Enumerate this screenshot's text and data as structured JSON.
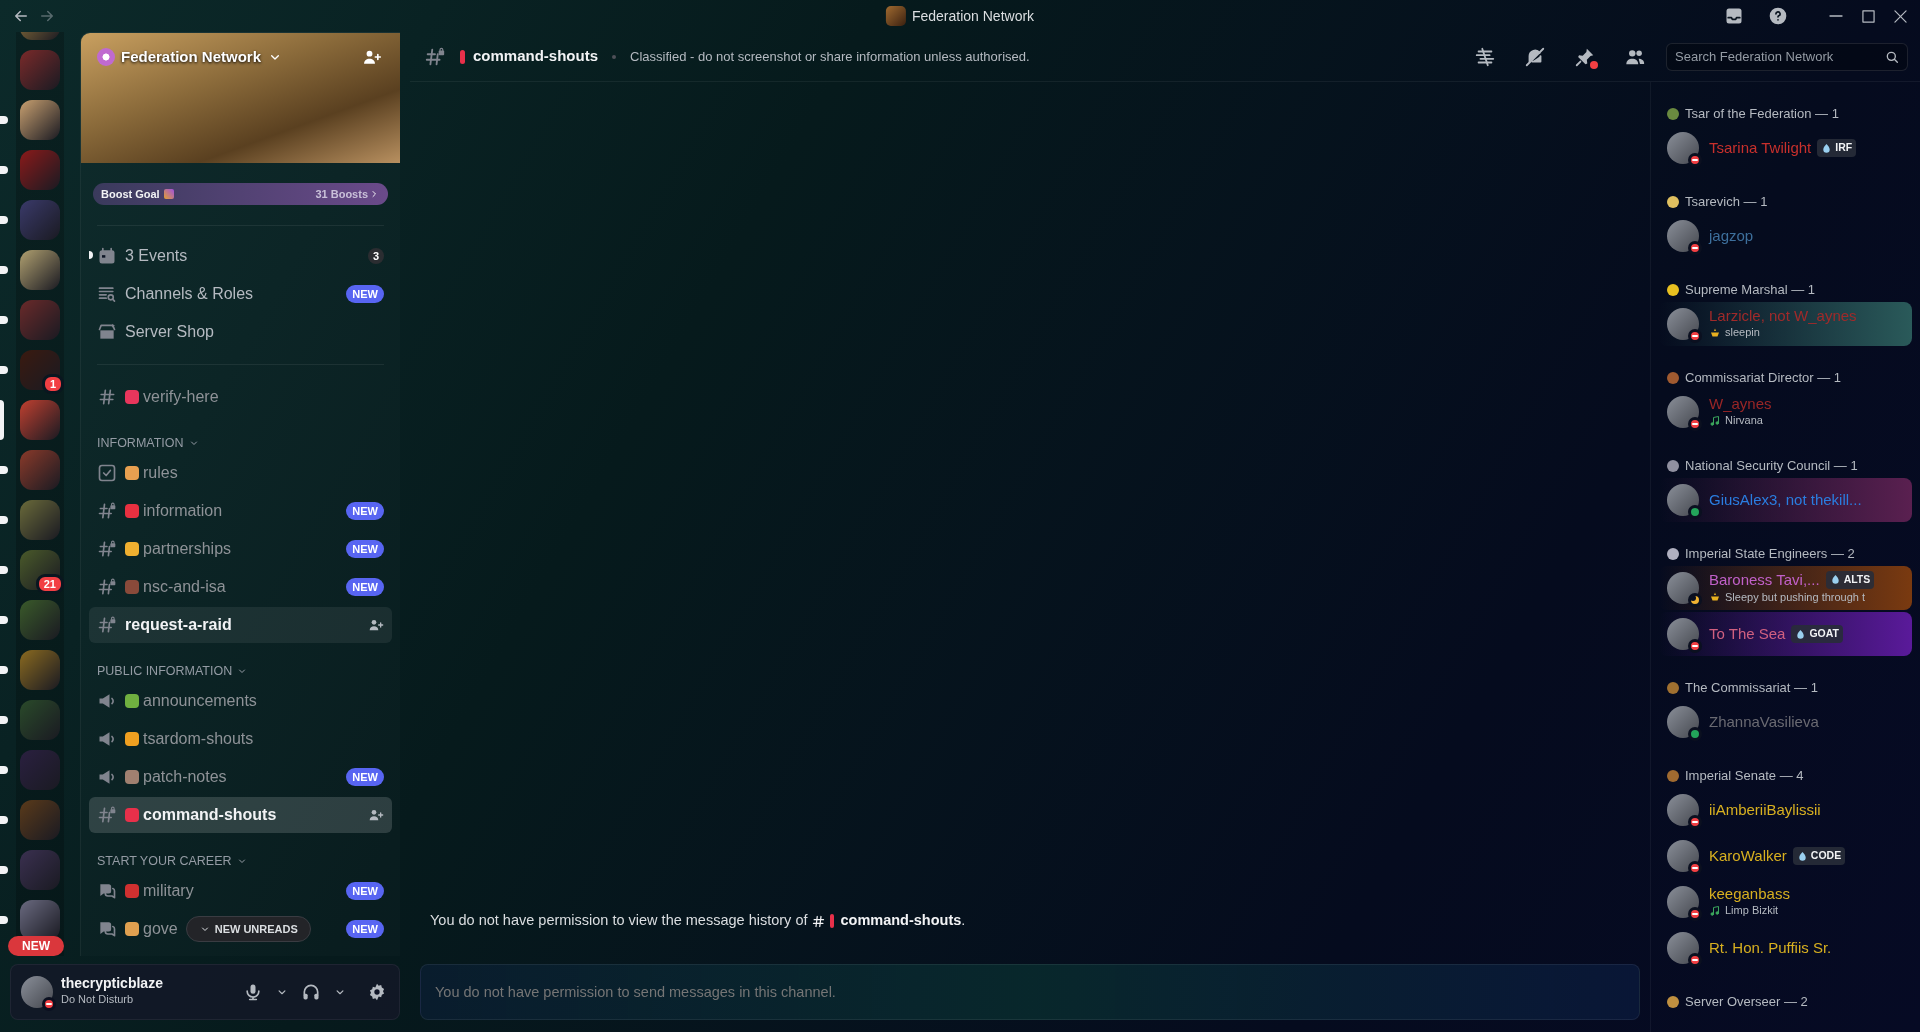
{
  "window": {
    "title": "Federation Network"
  },
  "servers": [
    {
      "unread": false,
      "selected": false
    },
    {
      "unread": true,
      "selected": false
    },
    {
      "unread": true,
      "selected": false
    },
    {
      "unread": true,
      "selected": false
    },
    {
      "unread": true,
      "selected": false
    },
    {
      "unread": true,
      "selected": false
    },
    {
      "unread": true,
      "selected": false,
      "badge": "1"
    },
    {
      "unread": false,
      "selected": true
    },
    {
      "unread": true,
      "selected": false
    },
    {
      "unread": true,
      "selected": false
    },
    {
      "unread": true,
      "selected": false,
      "badge": "21"
    },
    {
      "unread": true,
      "selected": false
    },
    {
      "unread": true,
      "selected": false
    },
    {
      "unread": true,
      "selected": false
    },
    {
      "unread": true,
      "selected": false
    },
    {
      "unread": true,
      "selected": false
    },
    {
      "unread": true,
      "selected": false
    },
    {
      "unread": true,
      "selected": false
    }
  ],
  "new_servers_pill": "NEW",
  "server": {
    "name": "Federation Network",
    "boost_label": "Boost Goal",
    "boost_count": "31 Boosts"
  },
  "shortcuts": [
    {
      "kind": "events",
      "label": "3 Events",
      "count": "3",
      "unread": true
    },
    {
      "kind": "browse",
      "label": "Channels & Roles",
      "badge": "NEW",
      "unread": false
    },
    {
      "kind": "shop",
      "label": "Server Shop",
      "unread": false
    }
  ],
  "channels": [
    {
      "kind": "text",
      "name": "verify-here",
      "color": "#e8365c",
      "unread": false,
      "selected": false,
      "hovered": false
    }
  ],
  "categories": [
    {
      "name": "INFORMATION",
      "channels": [
        {
          "kind": "rules",
          "name": "rules",
          "color": "#e8a050",
          "unread": false,
          "selected": false,
          "hovered": false
        },
        {
          "kind": "locked",
          "name": "information",
          "color": "#e83040",
          "badge": "NEW",
          "unread": false,
          "selected": false,
          "hovered": false
        },
        {
          "kind": "locked",
          "name": "partnerships",
          "color": "#f0b030",
          "badge": "NEW",
          "unread": false,
          "selected": false,
          "hovered": false
        },
        {
          "kind": "locked",
          "name": "nsc-and-isa",
          "color": "#8a4a3a",
          "badge": "NEW",
          "unread": false,
          "selected": false,
          "hovered": false
        },
        {
          "kind": "locked",
          "name": "request-a-raid",
          "unread": true,
          "selected": false,
          "hovered": true
        }
      ]
    },
    {
      "name": "PUBLIC INFORMATION",
      "channels": [
        {
          "kind": "announcement",
          "name": "announcements",
          "color": "#70b040",
          "unread": false,
          "selected": false,
          "hovered": false
        },
        {
          "kind": "announcement",
          "name": "tsardom-shouts",
          "color": "#f0a020",
          "unread": false,
          "selected": false,
          "hovered": false
        },
        {
          "kind": "announcement",
          "name": "patch-notes",
          "color": "#a08070",
          "badge": "NEW",
          "unread": false,
          "selected": false,
          "hovered": false
        },
        {
          "kind": "locked",
          "name": "command-shouts",
          "color": "#e8304a",
          "unread": true,
          "selected": true,
          "hovered": false
        }
      ]
    },
    {
      "name": "START YOUR CAREER",
      "channels": [
        {
          "kind": "forum",
          "name": "military",
          "color": "#d03030",
          "badge": "NEW",
          "unread": false,
          "selected": false,
          "hovered": false
        },
        {
          "kind": "forum",
          "name": "gove",
          "color": "#e0a050",
          "badge": "NEW",
          "unread": false,
          "selected": false,
          "hovered": false
        }
      ]
    }
  ],
  "new_unreads": "NEW UNREADS",
  "user": {
    "name": "thecrypticblaze",
    "status_text": "Do Not Disturb",
    "presence": {
      "kind": "dnd",
      "color": "#f23f43"
    }
  },
  "channel_header": {
    "name": "command-shouts",
    "emoji": {
      "color": "#e8304a"
    },
    "topic": "Classified - do not screenshot or share information unless authorised.",
    "search_placeholder": "Search Federation Network",
    "pins_unread": true
  },
  "history_notice": {
    "text": "You do not have permission to view the message history of",
    "channel": "command-shouts",
    "emoji": {
      "color": "#e8304a"
    },
    "end": "."
  },
  "composer": {
    "placeholder": "You do not have permission to send messages in this channel."
  },
  "member_groups": [
    {
      "title": "Tsar of the Federation — 1",
      "color": "#6a8a40",
      "members": [
        {
          "name": "Tsarina Twilight",
          "color": "#c8302c",
          "presence": {
            "kind": "dnd",
            "color": "#f23f43"
          },
          "tag": "IRF"
        }
      ]
    },
    {
      "title": "Tsarevich — 1",
      "color": "#e0c060",
      "members": [
        {
          "name": "jagzop",
          "color": "#3d6f9c",
          "presence": {
            "kind": "dnd",
            "color": "#f23f43"
          }
        }
      ]
    },
    {
      "title": "Supreme Marshal — 1",
      "color": "#e8c020",
      "members": [
        {
          "name": "Larzicle, not W_aynes",
          "color": "#a02a2a",
          "presence": {
            "kind": "dnd",
            "color": "#f23f43"
          },
          "activity": {
            "kind": "custom",
            "text": "sleepin"
          },
          "banner": {
            "color": "#2a5a5a"
          }
        }
      ]
    },
    {
      "title": "Commissariat Director — 1",
      "color": "#a05a30",
      "members": [
        {
          "name": "W_aynes",
          "color": "#9a2626",
          "presence": {
            "kind": "dnd",
            "color": "#f23f43"
          },
          "activity": {
            "kind": "music",
            "text": "Nirvana"
          }
        }
      ]
    },
    {
      "title": "National Security Council — 1",
      "color": "#9090a0",
      "members": [
        {
          "name": "GiusAlex3, not thekill...",
          "color": "#2a7de0",
          "presence": {
            "kind": "online",
            "color": "#23a55a"
          },
          "banner": {
            "color": "#5a2050"
          }
        }
      ]
    },
    {
      "title": "Imperial State Engineers — 2",
      "color": "#b0b0c0",
      "members": [
        {
          "name": "Baroness Tavi,...",
          "color": "#c060c8",
          "presence": {
            "kind": "idle",
            "color": "#f0b232"
          },
          "tag": "ALTS",
          "activity": {
            "kind": "custom",
            "text": "Sleepy but pushing through t"
          },
          "banner": {
            "color": "#7a3a10"
          }
        },
        {
          "name": "To The Sea",
          "color": "#d06080",
          "presence": {
            "kind": "dnd",
            "color": "#f23f43"
          },
          "tag": "GOAT",
          "banner": {
            "color": "#5a1a9a"
          }
        }
      ]
    },
    {
      "title": "The Commissariat — 1",
      "color": "#a07030",
      "members": [
        {
          "name": "ZhannaVasilieva",
          "color": "#6a6a72",
          "presence": {
            "kind": "online",
            "color": "#23a55a"
          }
        }
      ]
    },
    {
      "title": "Imperial Senate — 4",
      "color": "#a06a30",
      "members": [
        {
          "name": "iiAmberiiBaylissii",
          "color": "#d8b020",
          "presence": {
            "kind": "dnd",
            "color": "#f23f43"
          }
        },
        {
          "name": "KaroWalker",
          "color": "#d8b020",
          "presence": {
            "kind": "dnd",
            "color": "#f23f43"
          },
          "tag": "CODE"
        },
        {
          "name": "keeganbass",
          "color": "#d8b020",
          "presence": {
            "kind": "dnd",
            "color": "#f23f43"
          },
          "activity": {
            "kind": "music",
            "text": "Limp Bizkit"
          }
        },
        {
          "name": "Rt. Hon. Puffiis Sr.",
          "color": "#d8b020",
          "presence": {
            "kind": "dnd",
            "color": "#f23f43"
          }
        }
      ]
    },
    {
      "title": "Server Overseer — 2",
      "color": "#c09040"
    }
  ]
}
